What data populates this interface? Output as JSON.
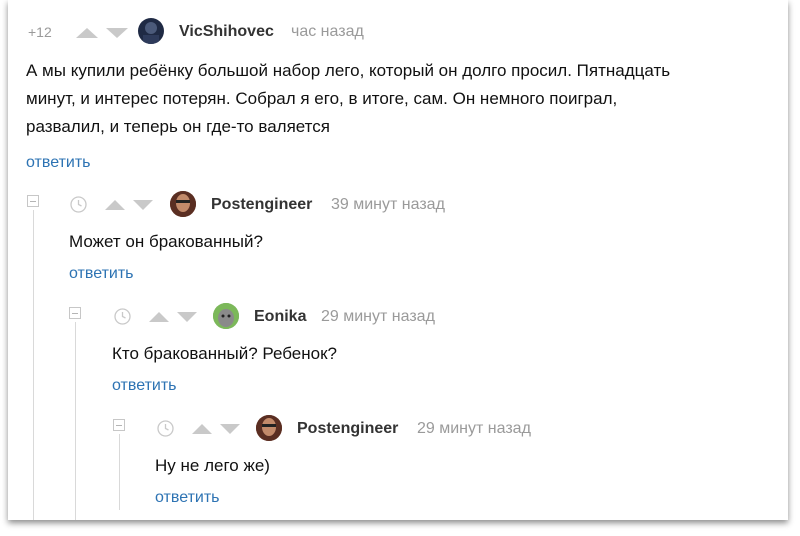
{
  "comments": [
    {
      "rating": "+12",
      "username": "VicShihovec",
      "time": "час назад",
      "lines": [
        "А мы купили ребёнку большой набор лего, который он долго просил. Пятнадцать",
        "минут, и интерес потерян. Собрал я его, в итоге, сам. Он немного поиграл,",
        "развалил, и теперь он где-то валяется"
      ],
      "reply_label": "ответить"
    },
    {
      "username": "Postengineer",
      "time": "39 минут назад",
      "text": "Может он бракованный?",
      "reply_label": "ответить"
    },
    {
      "username": "Eonika",
      "time": "29 минут назад",
      "text": "Кто бракованный? Ребенок?",
      "reply_label": "ответить"
    },
    {
      "username": "Postengineer",
      "time": "29 минут назад",
      "text": "Ну не лего же)",
      "reply_label": "ответить"
    }
  ],
  "colors": {
    "link": "#2d73b3",
    "meta": "#9a9a9a",
    "text": "#111111"
  },
  "icons": [
    "upvote-arrow-icon",
    "downvote-arrow-icon",
    "clock-icon",
    "collapse-icon"
  ]
}
